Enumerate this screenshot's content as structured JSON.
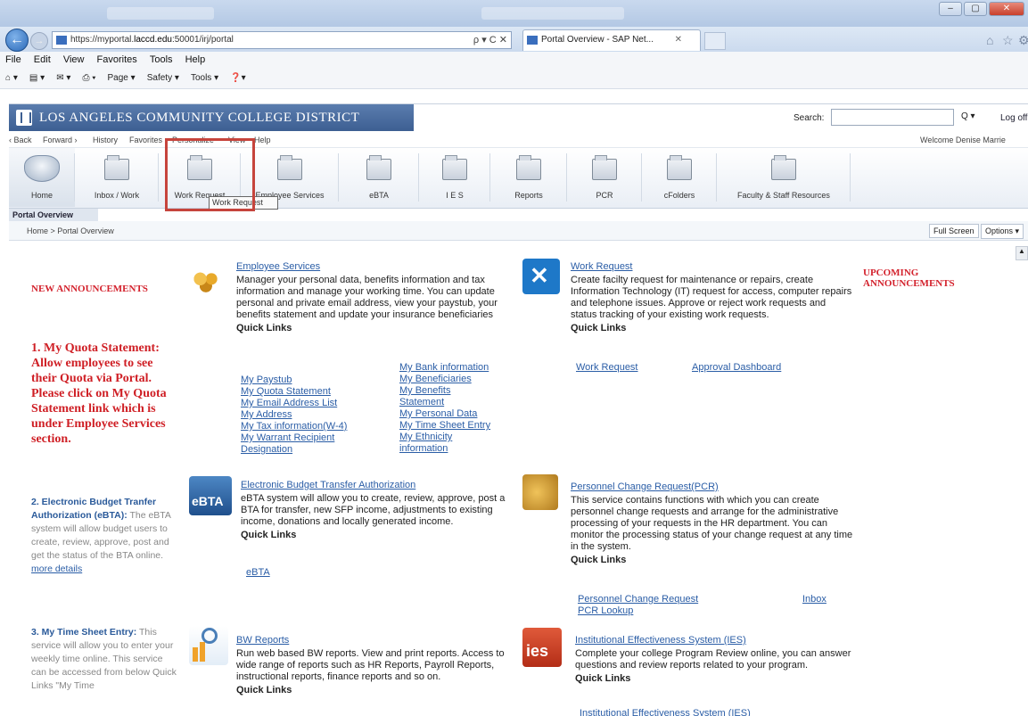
{
  "browser": {
    "url_prefix": "https://myportal.",
    "url_domain": "laccd.edu",
    "url_rest": ":50001/irj/portal",
    "address_controls": "ρ ▾ C ✕",
    "tab_title": "Portal Overview - SAP Net...",
    "tab_close": "✕",
    "menu": [
      "File",
      "Edit",
      "View",
      "Favorites",
      "Tools",
      "Help"
    ],
    "commands": [
      "Page ▾",
      "Safety ▾",
      "Tools ▾"
    ],
    "window_controls": [
      "–",
      "▢",
      "✕"
    ]
  },
  "portal": {
    "brand": "LOS ANGELES COMMUNITY COLLEGE DISTRICT",
    "search_label": "Search:",
    "search_go": "Q ▾",
    "logoff": "Log off",
    "nav": [
      "‹ Back",
      "Forward ›",
      "History",
      "Favorites",
      "Personalize",
      "View",
      "Help"
    ],
    "welcome": "Welcome  Denise Marrie",
    "tabs": [
      {
        "label": "Home"
      },
      {
        "label": "Inbox / Work"
      },
      {
        "label": "Work Request"
      },
      {
        "label": "Employee Services"
      },
      {
        "label": "eBTA"
      },
      {
        "label": "I E S"
      },
      {
        "label": "Reports"
      },
      {
        "label": "PCR"
      },
      {
        "label": "cFolders"
      },
      {
        "label": "Faculty & Staff Resources"
      }
    ],
    "tooltip": "Work Request",
    "page_tab": "Portal Overview",
    "breadcrumb": "Home  >  Portal Overview",
    "fullscreen": "Full Screen",
    "options": "Options ▾"
  },
  "announcements": {
    "title": "NEW ANNOUNCEMENTS",
    "item1": "1. My Quota Statement: Allow employees to see their Quota via Portal. Please click on My Quota Statement link which is under Employee Services section.",
    "item2_head": "2. Electronic Budget Tranfer Authorization (eBTA):",
    "item2_body": "The eBTA system will allow budget users to create, review, approve, post and get the status of the BTA online.",
    "item2_more": "more details",
    "item3_head": "3. My Time Sheet Entry:",
    "item3_body": "This service will allow you to enter your weekly time online. This service can be accessed from below Quick Links \"My Time"
  },
  "upcoming": "UPCOMING ANNOUNCEMENTS",
  "services": {
    "employee": {
      "title": "Employee Services",
      "desc": "Manager your personal data, benefits information and tax information and manage your working time. You can update personal and private email address, view your paystub, your benefits statement and update your insurance beneficiaries",
      "ql": "Quick Links",
      "links_left": [
        "My Paystub",
        "My Quota Statement",
        "My Email Address List",
        "My Address",
        "My Tax information(W-4)",
        "My Warrant Recipient",
        "Designation"
      ],
      "links_right": [
        "My Bank information",
        "My Beneficiaries",
        "My Benefits",
        "Statement",
        "My Personal Data",
        "My Time Sheet Entry",
        "My Ethnicity",
        "information"
      ]
    },
    "work": {
      "title": "Work Request",
      "desc": "Create facilty request for maintenance or repairs, create Information Technology (IT) request for access, computer repairs and telephone issues. Approve or reject work requests and status tracking of your existing work requests.",
      "ql": "Quick Links",
      "link1": "Work Request",
      "link2": "Approval Dashboard"
    },
    "ebta": {
      "title": "Electronic Budget Transfer Authorization",
      "desc": "eBTA system will allow you to create, review, approve, post a BTA for transfer, new SFP income, adjustments to existing income, donations and locally generated income.",
      "ql": "Quick Links",
      "link1": "eBTA",
      "icon_text": "eBTA"
    },
    "pcr": {
      "title": "Personnel Change Request(PCR)",
      "desc": "This service contains functions with which you can create personnel change requests and arrange for the administrative processing of your requests in the HR department. You can monitor the processing status of your change request at any time in the system.",
      "ql": "Quick Links",
      "link1": "Personnel Change Request",
      "link2": "Inbox",
      "link3": "PCR Lookup"
    },
    "bw": {
      "title": "BW Reports",
      "desc": "Run web based BW reports. View and print reports. Access to wide range of reports such as HR Reports, Payroll Reports, instructional reports, finance reports and so on.",
      "ql": "Quick Links"
    },
    "ies": {
      "title": "Institutional Effectiveness System (IES)",
      "desc": "Complete your college Program Review online, you can answer questions and review reports related to your program.",
      "ql": "Quick Links",
      "link1": "Institutional Effectiveness System (IES)",
      "icon_text": "ies"
    }
  },
  "colors": {
    "accent_red": "#d3212c",
    "link_blue": "#2a5da6",
    "brand_blue": "#3d5f92",
    "highlight": "#c6443c"
  }
}
